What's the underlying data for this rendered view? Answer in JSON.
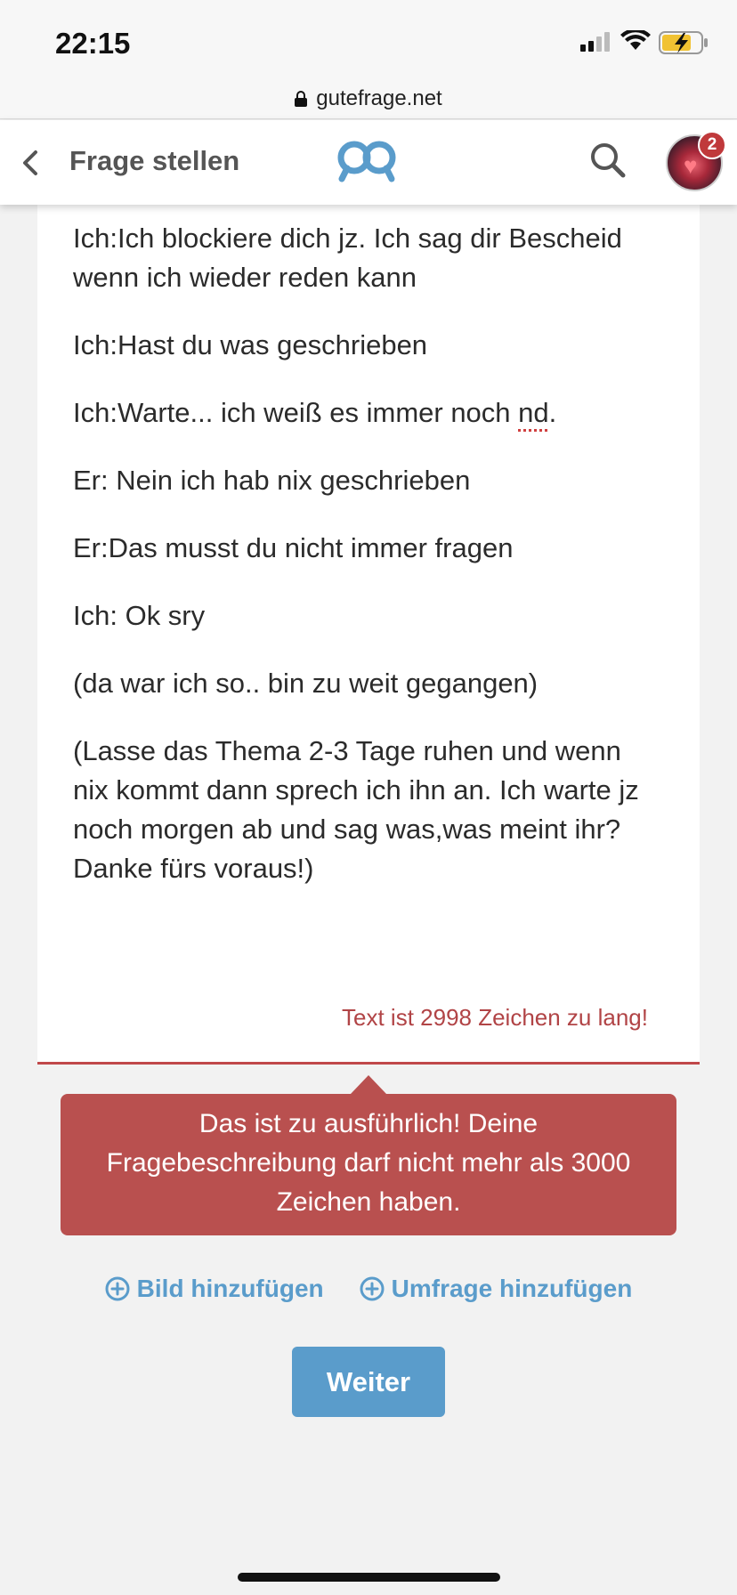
{
  "status_bar": {
    "time": "22:15"
  },
  "browser": {
    "url": "gutefrage.net"
  },
  "header": {
    "title": "Frage stellen",
    "notification_count": "2"
  },
  "editor": {
    "lines": [
      "Ich:Ich blockiere dich jz. Ich sag dir Bescheid wenn ich wieder reden kann",
      "Ich:Hast du was geschrieben",
      "Ich:Warte... ich weiß es immer noch ",
      "Er: Nein ich hab nix geschrieben",
      "Er:Das musst du nicht immer fragen",
      "Ich: Ok sry",
      "(da war ich so.. bin zu weit gegangen)",
      "(Lasse das Thema 2-3 Tage ruhen und wenn nix kommt dann sprech ich ihn an. Ich warte jz noch morgen ab und sag was,was meint ihr? Danke fürs voraus!)"
    ],
    "misspelled_word": "nd",
    "misspelled_suffix": ".",
    "char_error": "Text ist 2998 Zeichen zu lang!"
  },
  "error_tooltip": {
    "lines": [
      "Das ist zu ausführlich! Deine",
      "Fragebeschreibung darf nicht mehr als 3000",
      "Zeichen haben."
    ]
  },
  "actions": {
    "add_image": "Bild hinzufügen",
    "add_poll": "Umfrage hinzufügen"
  },
  "continue_button": "Weiter",
  "colors": {
    "accent_blue": "#5a9ccb",
    "error_red": "#b9504f",
    "error_text": "#b14446",
    "badge_red": "#c0393b"
  },
  "icons": [
    "lock-icon",
    "back-chevron-icon",
    "gutefrage-logo-icon",
    "search-icon",
    "plus-circle-icon"
  ]
}
